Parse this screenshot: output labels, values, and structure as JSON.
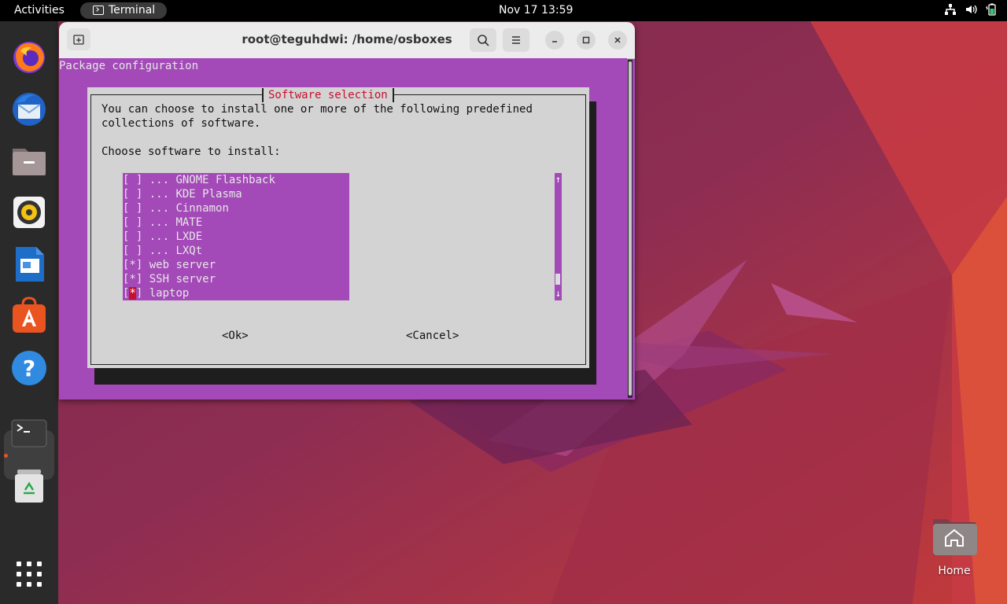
{
  "topbar": {
    "activities": "Activities",
    "app_name": "Terminal",
    "clock": "Nov 17  13:59",
    "tray_icons": [
      "network-icon",
      "volume-icon",
      "battery-icon"
    ]
  },
  "dock": {
    "apps": [
      {
        "name": "Firefox",
        "icon": "firefox-icon"
      },
      {
        "name": "Thunderbird",
        "icon": "thunderbird-icon"
      },
      {
        "name": "Files",
        "icon": "files-icon"
      },
      {
        "name": "Rhythmbox",
        "icon": "rhythmbox-icon"
      },
      {
        "name": "LibreOffice Writer",
        "icon": "writer-icon"
      },
      {
        "name": "Ubuntu Software",
        "icon": "software-icon"
      },
      {
        "name": "Help",
        "icon": "help-icon"
      },
      {
        "name": "Terminal",
        "icon": "terminal-icon",
        "active": true
      },
      {
        "name": "Trash",
        "icon": "trash-icon"
      },
      {
        "name": "Show Applications",
        "icon": "app-grid-icon"
      }
    ]
  },
  "window": {
    "title": "root@teguhdwi: /home/osboxes"
  },
  "terminal": {
    "header": "Package configuration",
    "dialog": {
      "title": "Software selection",
      "line1": "You can choose to install one or more of the following predefined",
      "line2": "collections of software.",
      "prompt": "Choose software to install:",
      "items": [
        {
          "mark": "[ ]",
          "label": "... GNOME Flashback"
        },
        {
          "mark": "[ ]",
          "label": "... KDE Plasma"
        },
        {
          "mark": "[ ]",
          "label": "... Cinnamon"
        },
        {
          "mark": "[ ]",
          "label": "... MATE"
        },
        {
          "mark": "[ ]",
          "label": "... LXDE"
        },
        {
          "mark": "[ ]",
          "label": "... LXQt"
        },
        {
          "mark": "[*]",
          "label": "web server"
        },
        {
          "mark": "[*]",
          "label": "SSH server"
        },
        {
          "mark_open": "[",
          "mark_cursor": "*",
          "mark_close": "]",
          "label": "laptop"
        }
      ],
      "scroll_up": "↑",
      "scroll_down": "↓",
      "ok": "<Ok>",
      "cancel": "<Cancel>"
    }
  },
  "desktop": {
    "home_label": "Home"
  },
  "colors": {
    "terminal_bg": "#a349b8",
    "dialog_bg": "#d3d3d3",
    "accent_red": "#c8102e",
    "ubuntu_orange": "#e95420"
  }
}
